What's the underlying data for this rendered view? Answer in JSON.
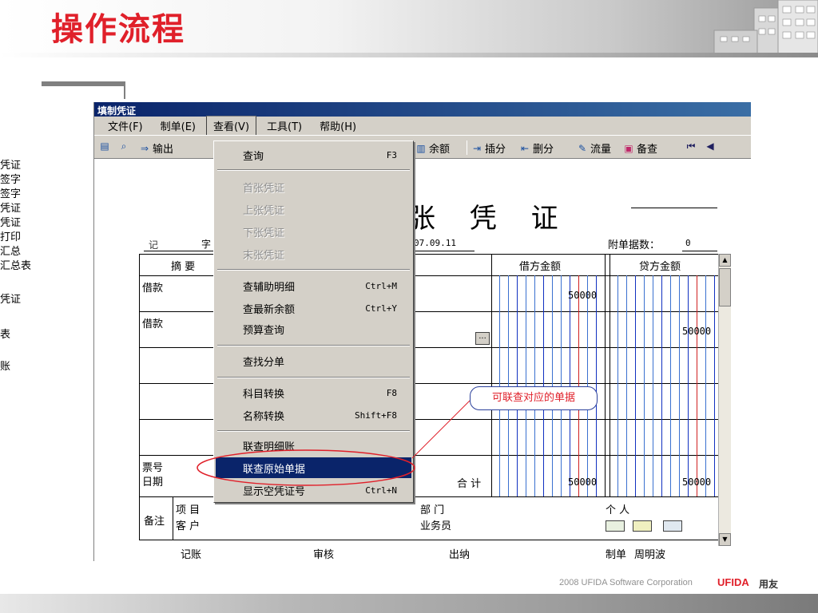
{
  "slide": {
    "title": "操作流程",
    "footer_text": "2008 UFIDA Software Corporation",
    "footer_brand": "UFIDA",
    "footer_brand_cn": "用友",
    "title_color": "#e0202a"
  },
  "left_nav": [
    "凭证",
    "签字",
    "签字",
    "凭证",
    "凭证",
    "打印",
    "汇总",
    "汇总表",
    "凭证",
    "表",
    "账"
  ],
  "window": {
    "title": "填制凭证",
    "menu": [
      "文件(F)",
      "制单(E)",
      "查看(V)",
      "工具(T)",
      "帮助(H)"
    ],
    "active_menu": "查看(V)",
    "toolbar": {
      "output": "输出",
      "balance": "余额",
      "insert": "插分",
      "delete": "删分",
      "flow": "流量",
      "backup": "备查"
    }
  },
  "voucher": {
    "title": "张  凭  证",
    "type": "记",
    "zi": "字",
    "date": "07.09.11",
    "attach_label": "附单据数：",
    "attach_value": "0",
    "headers": {
      "summary": "摘 要",
      "debit": "借方金额",
      "credit": "贷方金额"
    },
    "rows": [
      {
        "summary": "借款",
        "debit": "50000",
        "credit": ""
      },
      {
        "summary": "借款",
        "debit": "",
        "credit": "50000"
      }
    ],
    "footer_left1": "票号",
    "footer_left2": "日期",
    "total_label": "合 计",
    "total_debit": "50000",
    "total_credit": "50000",
    "remark": "备注",
    "project": "项  目",
    "customer": "客  户",
    "dept": "部  门",
    "salesman": "业务员",
    "person": "个  人",
    "sign_bookkeep": "记账",
    "sign_audit": "审核",
    "sign_cashier": "出纳",
    "sign_maker_label": "制单",
    "sign_maker": "周明波",
    "ellipsis": "..."
  },
  "dropdown": {
    "items": [
      {
        "label": "查询",
        "shortcut": "F3",
        "disabled": false
      },
      {
        "label": "首张凭证",
        "shortcut": "",
        "disabled": true
      },
      {
        "label": "上张凭证",
        "shortcut": "",
        "disabled": true
      },
      {
        "label": "下张凭证",
        "shortcut": "",
        "disabled": true
      },
      {
        "label": "末张凭证",
        "shortcut": "",
        "disabled": true
      },
      {
        "label": "查辅助明细",
        "shortcut": "Ctrl+M",
        "disabled": false
      },
      {
        "label": "查最新余额",
        "shortcut": "Ctrl+Y",
        "disabled": false
      },
      {
        "label": "预算查询",
        "shortcut": "",
        "disabled": false
      },
      {
        "label": "查找分单",
        "shortcut": "",
        "disabled": false
      },
      {
        "label": "科目转换",
        "shortcut": "F8",
        "disabled": false
      },
      {
        "label": "名称转换",
        "shortcut": "Shift+F8",
        "disabled": false
      },
      {
        "label": "联查明细账",
        "shortcut": "",
        "disabled": false
      },
      {
        "label": "联查原始单据",
        "shortcut": "",
        "disabled": false,
        "highlighted": true
      },
      {
        "label": "显示空凭证号",
        "shortcut": "Ctrl+N",
        "disabled": false
      }
    ]
  },
  "callout": {
    "text": "可联查对应的单据",
    "color": "#e0202a"
  }
}
